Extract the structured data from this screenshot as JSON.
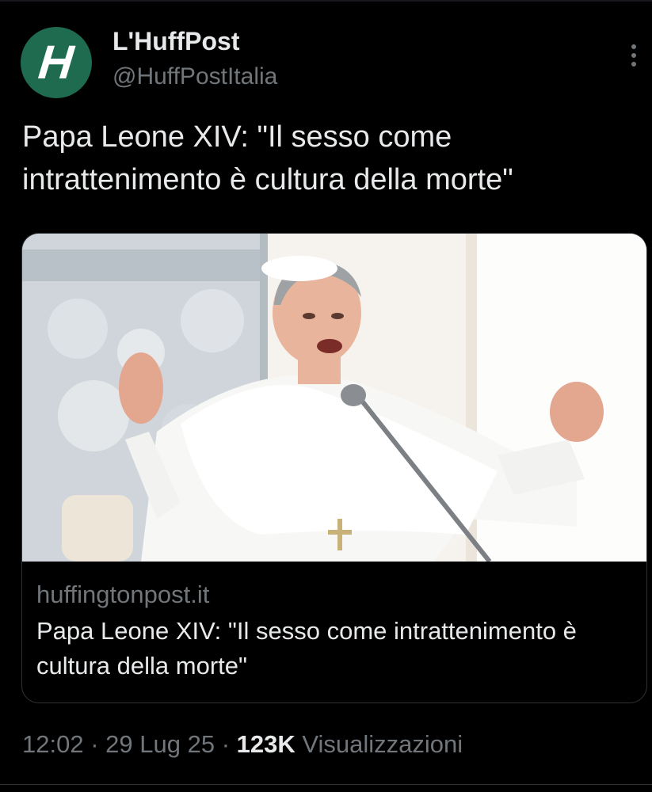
{
  "author": {
    "avatar_letter": "H",
    "avatar_color": "#1f6b4f",
    "display_name": "L'HuffPost",
    "handle": "@HuffPostItalia"
  },
  "tweet": {
    "text": "Papa Leone XIV: \"Il sesso come intrattenimento è cultura della morte\""
  },
  "card": {
    "image_icon": "pope-photo",
    "domain": "huffingtonpost.it",
    "title": "Papa Leone XIV: \"Il sesso come intrattenimento è cultura della morte\""
  },
  "meta": {
    "time": "12:02",
    "separator": "·",
    "date": "29 Lug 25",
    "views_count": "123K",
    "views_label": "Visualizzazioni"
  },
  "icons": {
    "more": "more-dots-icon"
  },
  "colors": {
    "background": "#000000",
    "primary_text": "#e7e9ea",
    "secondary_text": "#71767b",
    "border": "#2f3336"
  }
}
